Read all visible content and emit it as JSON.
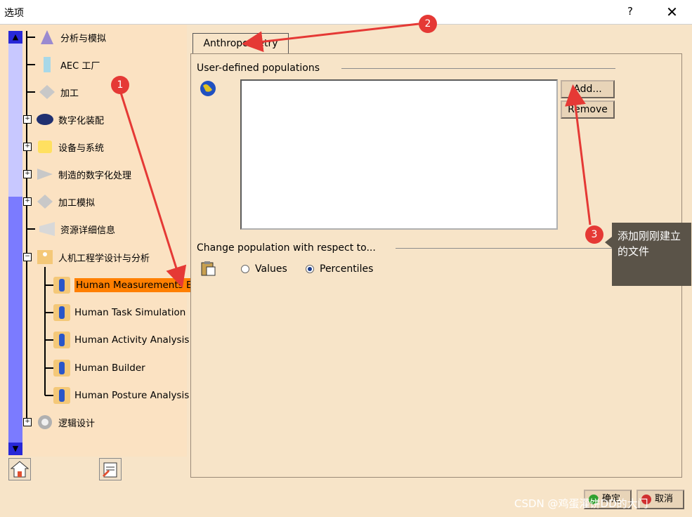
{
  "window": {
    "title": "选项",
    "help_label": "?",
    "close_label": "✕"
  },
  "tree": {
    "nodes": [
      {
        "label": "分析与模拟",
        "expandable": false
      },
      {
        "label": "AEC 工厂",
        "expandable": false
      },
      {
        "label": "加工",
        "expandable": false
      },
      {
        "label": "数字化装配",
        "expandable": true
      },
      {
        "label": "设备与系统",
        "expandable": true
      },
      {
        "label": "制造的数字化处理",
        "expandable": true
      },
      {
        "label": "加工模拟",
        "expandable": true
      },
      {
        "label": "资源详细信息",
        "expandable": false
      },
      {
        "label": "人机工程学设计与分析",
        "expandable": true
      },
      {
        "label": "逻辑设计",
        "expandable": true
      }
    ],
    "children": [
      {
        "label": "Human Measurements E",
        "selected": true
      },
      {
        "label": "Human Task Simulation",
        "selected": false
      },
      {
        "label": "Human Activity Analysis",
        "selected": false
      },
      {
        "label": "Human Builder",
        "selected": false
      },
      {
        "label": "Human Posture Analysis",
        "selected": false
      }
    ],
    "expand_sign": "+",
    "collapse_sign": "−",
    "scroll_up": "▲",
    "scroll_down": "▼"
  },
  "tab": {
    "label": "Anthropometry"
  },
  "user_defined": {
    "label": "User-defined populations",
    "add_label": "Add...",
    "remove_label": "Remove"
  },
  "change_population": {
    "label": "Change population with respect to...",
    "options": [
      {
        "label": "Values",
        "selected": false
      },
      {
        "label": "Percentiles",
        "selected": true
      }
    ]
  },
  "annotations": {
    "one": "1",
    "two": "2",
    "three": "3",
    "tooltip": "添加刚刚建立的文件"
  },
  "footer": {
    "ok_label": "确定",
    "cancel_label": "取消",
    "watermark": "CSDN @鸡蛋灌饼DD的大门"
  },
  "colors": {
    "selection": "#ff7f00",
    "annotation": "#e53935",
    "scroll_thumb": "#7b7bff"
  }
}
